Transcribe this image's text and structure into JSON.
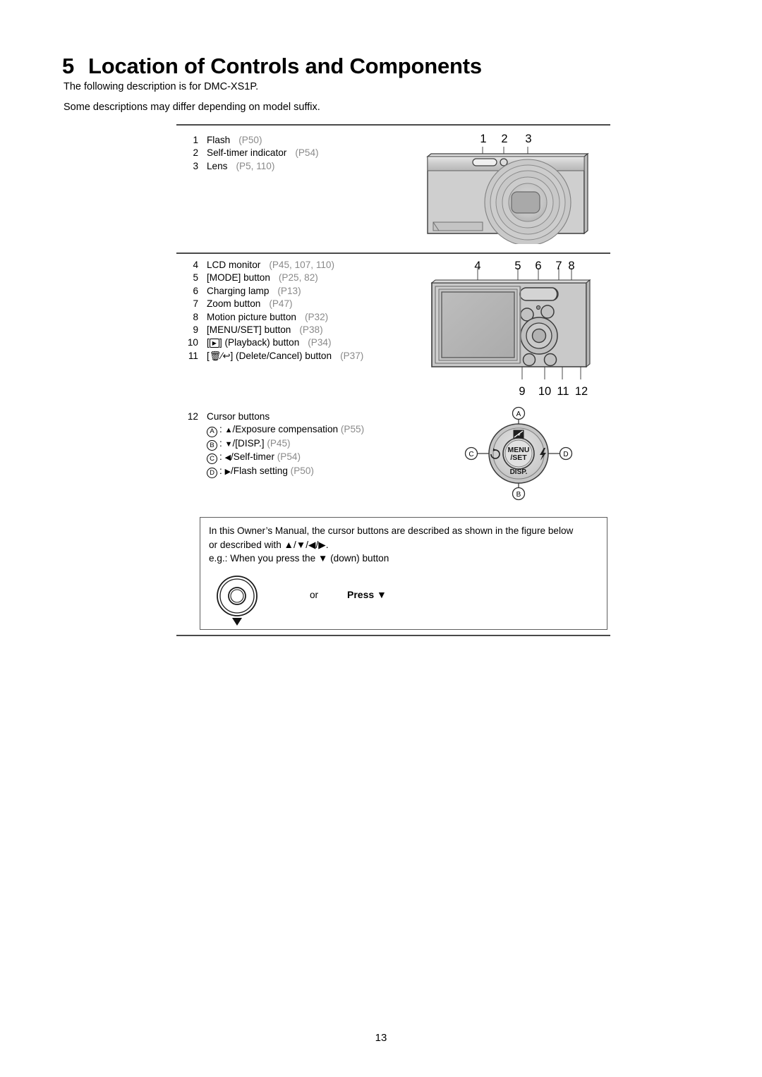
{
  "heading": {
    "number": "5",
    "title": "Location of Controls and Components"
  },
  "intro": {
    "line1": "The following description is for DMC-XS1P.",
    "line2": "Some descriptions may differ depending on model suffix."
  },
  "front_list": [
    {
      "index": "1",
      "label": "Flash",
      "ref": "(P50)"
    },
    {
      "index": "2",
      "label": "Self-timer indicator",
      "ref": "(P54)"
    },
    {
      "index": "3",
      "label": "Lens",
      "ref": "(P5, 110)"
    }
  ],
  "back_list": [
    {
      "index": "4",
      "label": "LCD monitor",
      "ref": "(P45, 107, 110)"
    },
    {
      "index": "5",
      "label": "[MODE] button",
      "ref": "(P25, 82)"
    },
    {
      "index": "6",
      "label": "Charging lamp",
      "ref": "(P13)"
    },
    {
      "index": "7",
      "label": "Zoom button",
      "ref": "(P47)"
    },
    {
      "index": "8",
      "label": "Motion picture button",
      "ref": "(P32)"
    },
    {
      "index": "9",
      "label": "[MENU/SET] button",
      "ref": "(P38)"
    },
    {
      "index": "10",
      "label_pre": "[",
      "icon": "playback-icon",
      "label_post": "] (Playback) button",
      "ref": "(P34)"
    },
    {
      "index": "11",
      "label_pre": "[",
      "icon": "delete-cancel-icon",
      "label_post": "] (Delete/Cancel) button",
      "ref": "(P37)"
    }
  ],
  "cursor_list": {
    "index": "12",
    "label": "Cursor buttons",
    "items": [
      {
        "mark": "A",
        "arrow": "▲",
        "label": "/Exposure compensation",
        "ref": "(P55)"
      },
      {
        "mark": "B",
        "arrow": "▼",
        "label": "/[DISP.]",
        "ref": "(P45)"
      },
      {
        "mark": "C",
        "arrow": "◀",
        "label": "/Self-timer",
        "ref": "(P54)"
      },
      {
        "mark": "D",
        "arrow": "▶",
        "label": "/Flash setting",
        "ref": "(P50)"
      }
    ]
  },
  "front_callouts": [
    "1",
    "2",
    "3"
  ],
  "back_callouts_top": [
    "4",
    "5",
    "6",
    "7",
    "8"
  ],
  "back_callouts_bottom": [
    "9",
    "10",
    "11",
    "12"
  ],
  "dial_marks": {
    "top": "A",
    "bottom": "B",
    "left": "C",
    "right": "D",
    "center_line1": "MENU",
    "center_line2": "/SET",
    "bottom_label": "DISP."
  },
  "note": {
    "line1": "In this Owner’s Manual, the cursor buttons are described as shown in the figure below",
    "line2_pre": "or described with ",
    "line2_arrows": "▲/▼/◀/▶",
    "line2_post": ".",
    "line3_pre": "e.g.: When you press the ",
    "line3_arrow": "▼",
    "line3_post": " (down) button",
    "or_label": "or",
    "press_label": "Press ▼"
  },
  "page_number": "13",
  "colors": {
    "rule": "#4a4a4a",
    "ref_text": "#8a8a8a",
    "body_gray": "#c6c6c6",
    "body_gray_dark": "#ababab",
    "leader": "#8d8d8d"
  }
}
